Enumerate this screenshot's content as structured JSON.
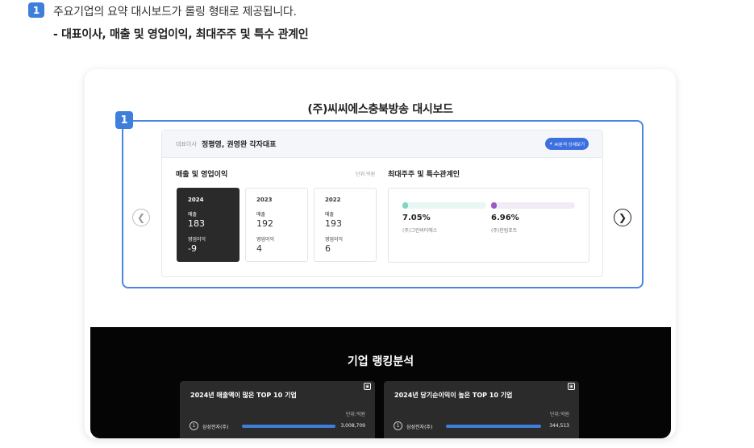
{
  "header": {
    "step": "1",
    "intro": "주요기업의 요약 대시보드가 롤링 형태로 제공됩니다.",
    "subtitle": "- 대표이사, 매출 및 영업이익, 최대주주 및 특수 관계인"
  },
  "card": {
    "title": "(주)씨씨에스충북방송 대시보드",
    "highlight_badge": "1",
    "nav": {
      "prev_icon": "chevron-left-icon",
      "next_icon": "chevron-right-icon"
    },
    "ceo": {
      "label": "대표이사",
      "name": "정평영, 권영완 각자대표"
    },
    "detail_button": "AI분석 상세보기",
    "sales": {
      "title": "매출 및 영업이익",
      "unit": "단위:억원",
      "years": [
        {
          "year": "2024",
          "sales_label": "매출",
          "sales": "183",
          "op_label": "영업이익",
          "op": "-9",
          "active": true
        },
        {
          "year": "2023",
          "sales_label": "매출",
          "sales": "192",
          "op_label": "영업이익",
          "op": "4",
          "active": false
        },
        {
          "year": "2022",
          "sales_label": "매출",
          "sales": "193",
          "op_label": "영업이익",
          "op": "6",
          "active": false
        }
      ]
    },
    "holders": {
      "title": "최대주주 및 특수관계인",
      "items": [
        {
          "pct": "7.05%",
          "name": "(주)그린비티에스",
          "color": "#7fd6c2",
          "track": "#e8f7f3",
          "value": 7.05
        },
        {
          "pct": "6.96%",
          "name": "(주)한림포트",
          "color": "#9b5bc7",
          "track": "#f2ebf6",
          "value": 6.96
        }
      ]
    }
  },
  "ranking": {
    "title": "기업 랭킹분석",
    "cards": [
      {
        "title": "2024년 매출액이 많은 TOP 10 기업",
        "unit": "단위:억원",
        "rank": "1",
        "company": "삼성전자(주)",
        "value": "3,008,709"
      },
      {
        "title": "2024년 당기순이익이 높은 TOP 10 기업",
        "unit": "단위:억원",
        "rank": "1",
        "company": "삼성전자(주)",
        "value": "344,513"
      }
    ]
  },
  "colors": {
    "accent": "#3f7fdc",
    "dark": "#2a2a2a",
    "ranking_bg": "#050505"
  }
}
